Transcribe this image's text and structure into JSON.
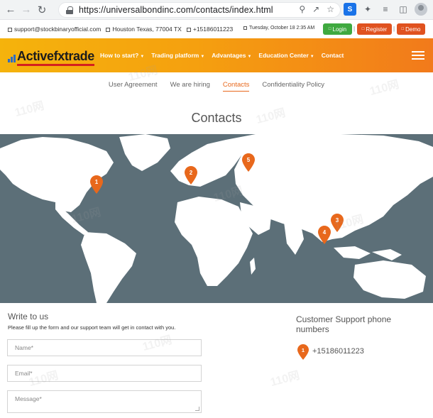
{
  "browser": {
    "url": "https://universalbondinc.com/contacts/index.html"
  },
  "infobar": {
    "email": "support@stockbinaryofficial.com",
    "address": "Houston Texas, 77004 TX",
    "phone": "+15186011223",
    "date": "Tuesday, October 18 2:35 AM",
    "login": "Login",
    "register": "Register",
    "demo": "Demo"
  },
  "header": {
    "logo": "Activefxtrade",
    "menu": [
      {
        "label": "How to start?"
      },
      {
        "label": "Trading platform"
      },
      {
        "label": "Advantages"
      },
      {
        "label": "Education Center"
      },
      {
        "label": "Contact"
      }
    ]
  },
  "subnav": [
    {
      "label": "User Agreement"
    },
    {
      "label": "We are hiring"
    },
    {
      "label": "Contacts"
    },
    {
      "label": "Confidentiality Policy"
    }
  ],
  "page": {
    "title": "Contacts"
  },
  "map": {
    "pins": [
      "1",
      "2",
      "3",
      "4",
      "5"
    ]
  },
  "form": {
    "title": "Write to us",
    "subtitle": "Please fill up the form and our support team will get in contact with you.",
    "name_placeholder": "Name*",
    "email_placeholder": "Email*",
    "message_placeholder": "Message*"
  },
  "support": {
    "title": "Customer Support phone numbers",
    "pin": "1",
    "phone": "+15186011223"
  },
  "colors": {
    "accent": "#e8681c",
    "map_bg": "#5c6f78",
    "login": "#3fa93f",
    "register": "#e0521f"
  },
  "watermark": "110网"
}
